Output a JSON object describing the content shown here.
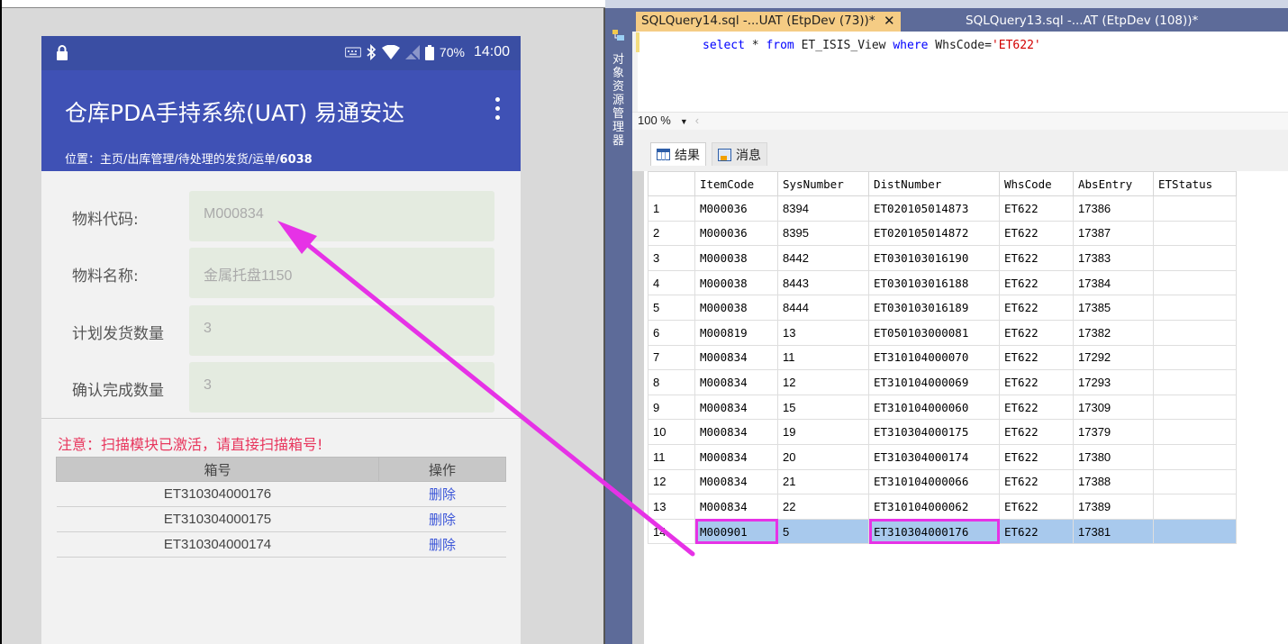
{
  "phone": {
    "status_bar": {
      "battery": "70%",
      "time": "14:00"
    },
    "app_title": "仓库PDA手持系统(UAT) 易通安达",
    "breadcrumb_prefix": "位置：主页/出库管理/待处理的发货/运单/",
    "breadcrumb_id": "6038",
    "fields": [
      {
        "label": "物料代码:",
        "value": "M000834"
      },
      {
        "label": "物料名称:",
        "value": "金属托盘1150"
      },
      {
        "label": "计划发货数量",
        "value": "3"
      },
      {
        "label": "确认完成数量",
        "value": "3"
      }
    ],
    "notice": "注意：扫描模块已激活，请直接扫描箱号!",
    "scan_table": {
      "headers": [
        "箱号",
        "操作"
      ],
      "rows": [
        {
          "box": "ET310304000176",
          "action": "删除"
        },
        {
          "box": "ET310304000175",
          "action": "删除"
        },
        {
          "box": "ET310304000174",
          "action": "删除"
        }
      ]
    }
  },
  "ssms": {
    "side_panel_label": "对象资源管理器",
    "tabs": [
      {
        "label": "SQLQuery14.sql -...UAT (EtpDev (73))*",
        "active": true
      },
      {
        "label": "SQLQuery13.sql -...AT (EtpDev (108))*",
        "active": false
      }
    ],
    "query": {
      "kw1": "select",
      "star": " * ",
      "kw2": "from",
      "table": " ET_ISIS_View ",
      "kw3": "where",
      "cond": " WhsCode=",
      "literal": "'ET622'"
    },
    "zoom": "100 %",
    "result_tabs": [
      "结果",
      "消息"
    ],
    "columns": [
      "",
      "ItemCode",
      "SysNumber",
      "DistNumber",
      "WhsCode",
      "AbsEntry",
      "ETStatus"
    ],
    "rows": [
      [
        "1",
        "M000036",
        "8394",
        "ET020105014873",
        "ET622",
        "17386",
        ""
      ],
      [
        "2",
        "M000036",
        "8395",
        "ET020105014872",
        "ET622",
        "17387",
        ""
      ],
      [
        "3",
        "M000038",
        "8442",
        "ET030103016190",
        "ET622",
        "17383",
        ""
      ],
      [
        "4",
        "M000038",
        "8443",
        "ET030103016188",
        "ET622",
        "17384",
        ""
      ],
      [
        "5",
        "M000038",
        "8444",
        "ET030103016189",
        "ET622",
        "17385",
        ""
      ],
      [
        "6",
        "M000819",
        "13",
        "ET050103000081",
        "ET622",
        "17382",
        ""
      ],
      [
        "7",
        "M000834",
        "11",
        "ET310104000070",
        "ET622",
        "17292",
        ""
      ],
      [
        "8",
        "M000834",
        "12",
        "ET310104000069",
        "ET622",
        "17293",
        ""
      ],
      [
        "9",
        "M000834",
        "15",
        "ET310104000060",
        "ET622",
        "17309",
        ""
      ],
      [
        "10",
        "M000834",
        "19",
        "ET310304000175",
        "ET622",
        "17379",
        ""
      ],
      [
        "11",
        "M000834",
        "20",
        "ET310304000174",
        "ET622",
        "17380",
        ""
      ],
      [
        "12",
        "M000834",
        "21",
        "ET310104000066",
        "ET622",
        "17388",
        ""
      ],
      [
        "13",
        "M000834",
        "22",
        "ET310104000062",
        "ET622",
        "17389",
        ""
      ],
      [
        "14",
        "M000901",
        "5",
        "ET310304000176",
        "ET622",
        "17381",
        ""
      ]
    ],
    "selected_row": 13,
    "annotation_color": "#e632e6"
  }
}
